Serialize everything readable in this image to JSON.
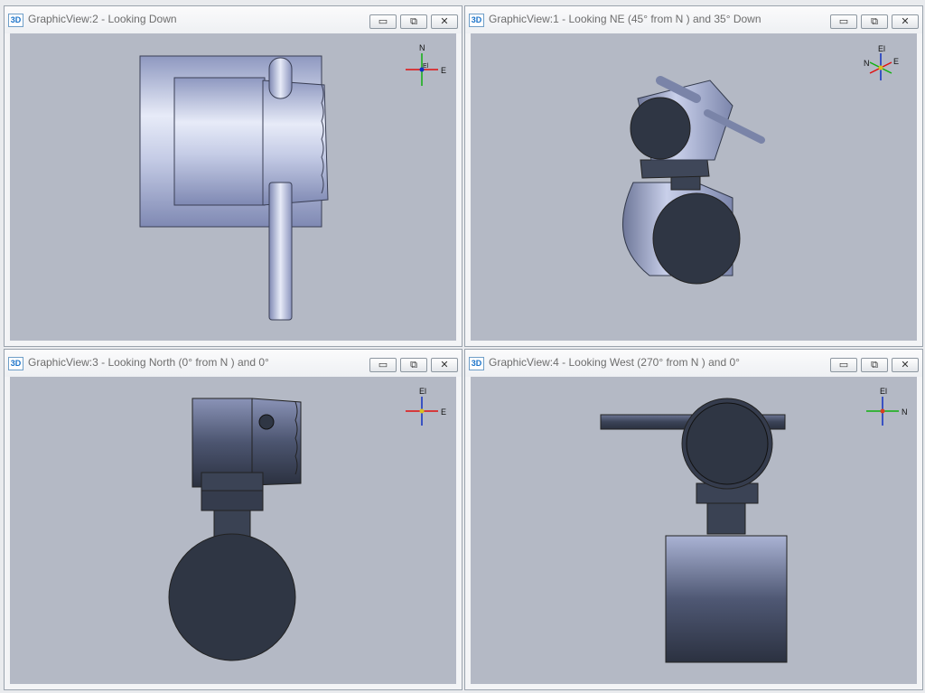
{
  "views": [
    {
      "id": "v2",
      "title": "GraphicView:2 - Looking Down",
      "icon_label": "3D",
      "axes": {
        "up": "N",
        "right": "E",
        "center": "El"
      }
    },
    {
      "id": "v1",
      "title": "GraphicView:1 - Looking NE (45° from N ) and 35° Down",
      "icon_label": "3D",
      "axes": {
        "up": "El",
        "left": "N",
        "right": "E"
      }
    },
    {
      "id": "v3",
      "title": "GraphicView:3 - Looking North (0° from N ) and 0°",
      "icon_label": "3D",
      "axes": {
        "up": "El",
        "right": "E"
      }
    },
    {
      "id": "v4",
      "title": "GraphicView:4 - Looking West (270° from N ) and 0°",
      "icon_label": "3D",
      "axes": {
        "up": "El",
        "right": "N"
      }
    }
  ],
  "window_buttons": {
    "minimize": "▭",
    "restore": "⧉",
    "close": "✕"
  },
  "icons": {
    "view": "3d-view-icon",
    "minimize": "minimize-icon",
    "restore": "restore-icon",
    "close": "close-icon"
  },
  "colors": {
    "viewport_bg": "#b4b9c5",
    "model_light": "#c8d0ea",
    "model_dark": "#2f3644",
    "axis_red": "#e01010",
    "axis_green": "#10b010",
    "axis_blue": "#1030c0"
  }
}
